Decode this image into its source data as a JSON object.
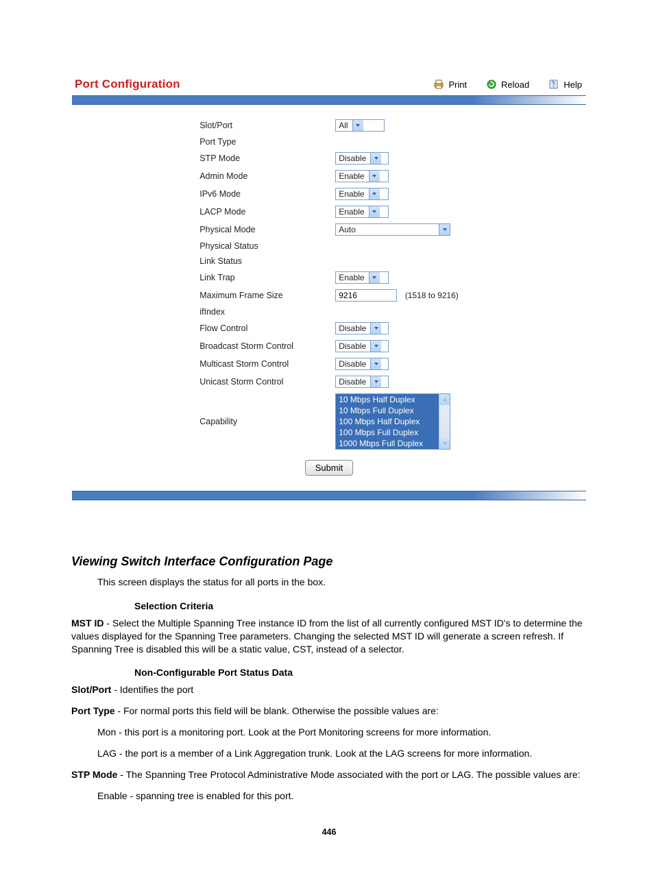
{
  "header": {
    "title": "Port Configuration",
    "toolbar": {
      "print": "Print",
      "reload": "Reload",
      "help": "Help"
    }
  },
  "form": {
    "labels": {
      "slot_port": "Slot/Port",
      "port_type": "Port Type",
      "stp_mode": "STP Mode",
      "admin_mode": "Admin Mode",
      "ipv6_mode": "IPv6 Mode",
      "lacp_mode": "LACP Mode",
      "physical_mode": "Physical Mode",
      "physical_status": "Physical Status",
      "link_status": "Link Status",
      "link_trap": "Link Trap",
      "max_frame": "Maximum Frame Size",
      "ifindex": "ifIndex",
      "flow_control": "Flow Control",
      "bcast_storm": "Broadcast Storm Control",
      "mcast_storm": "Multicast Storm Control",
      "ucast_storm": "Unicast Storm Control",
      "capability": "Capability"
    },
    "values": {
      "slot_port": "All",
      "stp_mode": "Disable",
      "admin_mode": "Enable",
      "ipv6_mode": "Enable",
      "lacp_mode": "Enable",
      "physical_mode": "Auto",
      "link_trap": "Enable",
      "max_frame": "9216",
      "max_frame_hint": "(1518 to 9216)",
      "flow_control": "Disable",
      "bcast_storm": "Disable",
      "mcast_storm": "Disable",
      "ucast_storm": "Disable"
    },
    "capability_options": [
      "10 Mbps Half Duplex",
      "10 Mbps Full Duplex",
      "100 Mbps Half Duplex",
      "100 Mbps Full Duplex",
      "1000 Mbps Full Duplex"
    ],
    "submit": "Submit"
  },
  "doc": {
    "heading": "Viewing Switch Interface Configuration Page",
    "intro": "This screen displays the status for all ports in the box.",
    "selection_criteria_label": "Selection Criteria",
    "mst_id_bold": "MST ID",
    "mst_id_rest": " - Select the Multiple Spanning Tree instance ID from the list of all currently configured MST ID's to determine the values displayed for the Spanning Tree parameters. Changing the selected MST ID will generate a screen refresh. If Spanning Tree is disabled this will be a static value, CST, instead of a selector.",
    "noncfg_label": "Non-Configurable Port Status Data",
    "slot_port_bold": "Slot/Port",
    "slot_port_rest": " - Identifies the port",
    "port_type_bold": "Port Type",
    "port_type_rest": " - For normal ports this field will be blank. Otherwise the possible values are:",
    "port_type_mon": "Mon - this port is a monitoring port. Look at the Port Monitoring screens for more information.",
    "port_type_lag": "LAG - the port is a member of a Link Aggregation trunk. Look at the LAG screens for more information.",
    "stp_mode_bold": "STP Mode",
    "stp_mode_rest": " - The Spanning Tree Protocol Administrative Mode associated with the port or LAG. The possible values are:",
    "stp_enable": "Enable - spanning tree is enabled for this port.",
    "page_number": "446"
  }
}
